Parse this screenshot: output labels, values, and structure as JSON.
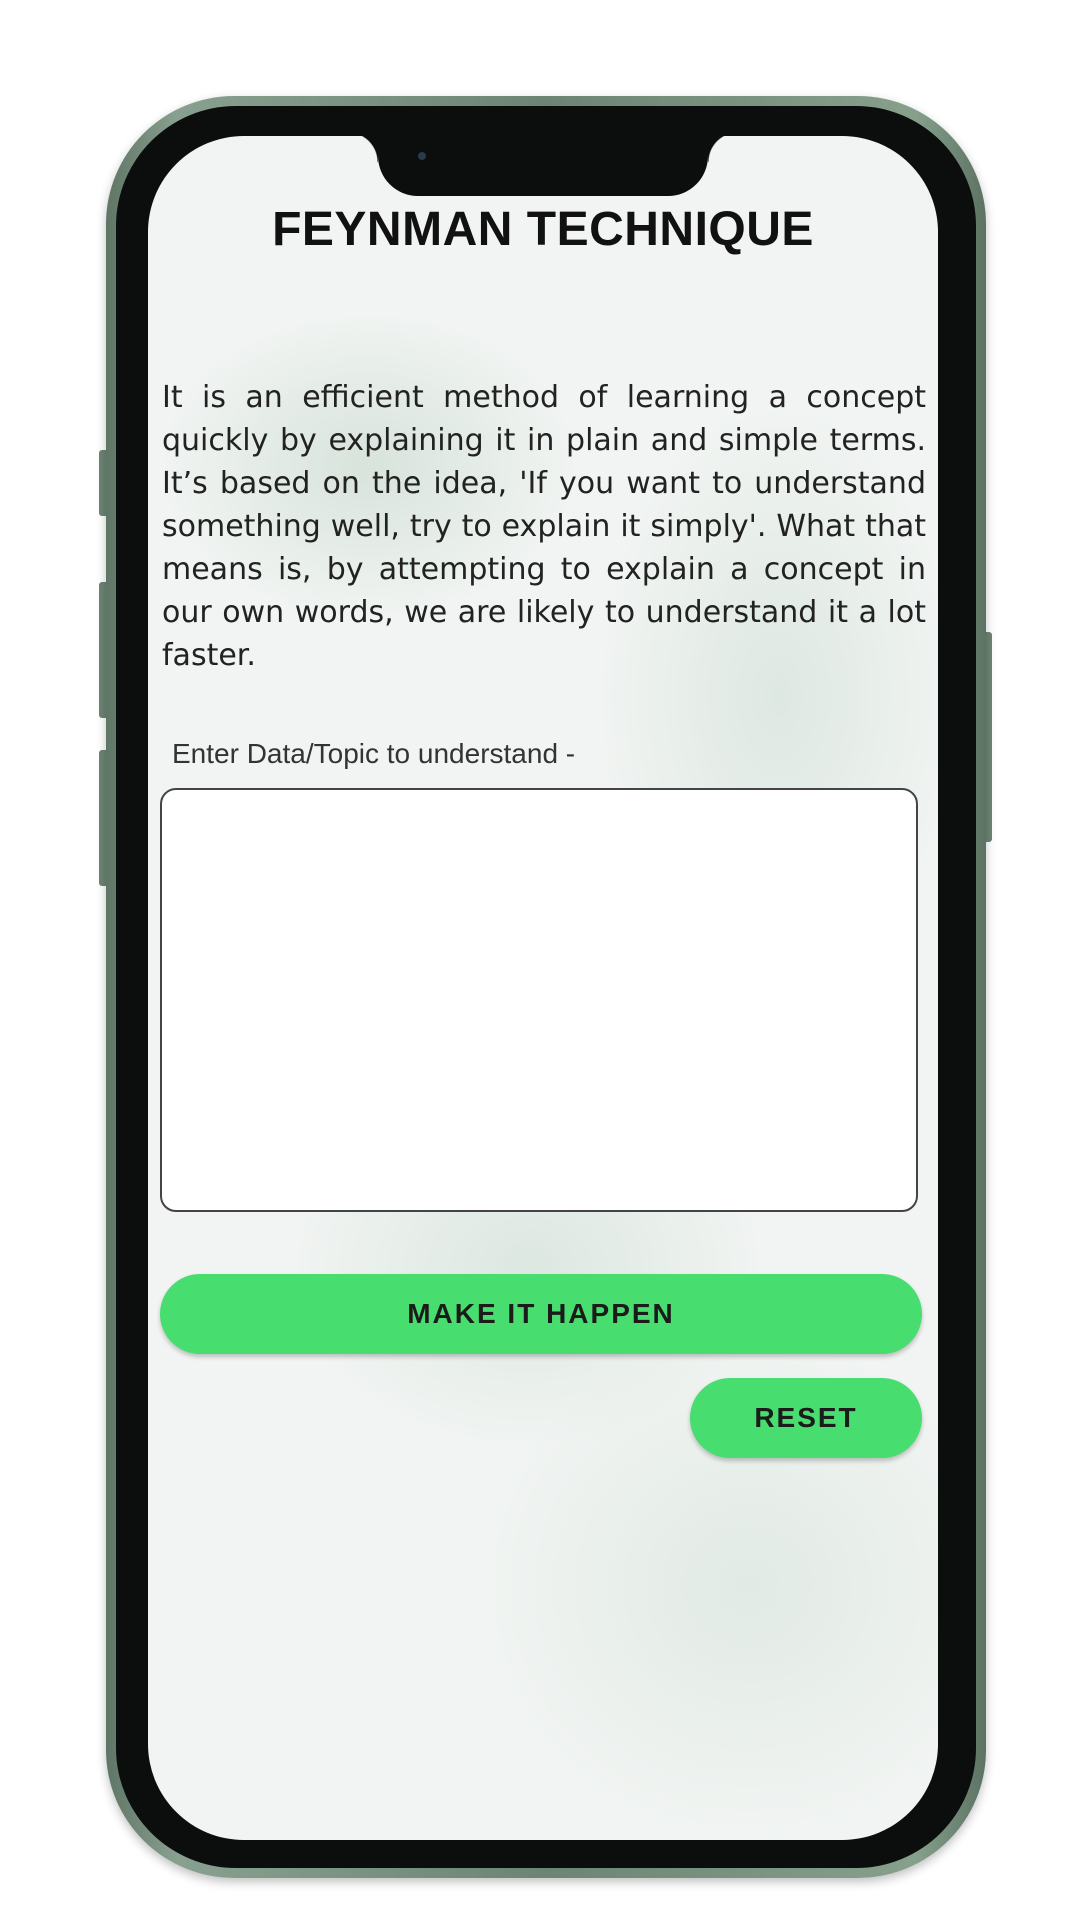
{
  "app": {
    "title": "FEYNMAN TECHNIQUE",
    "description": "It is an efficient method of learning a concept quickly by explaining it in plain and simple terms. It’s based on the idea, 'If you want to understand something well, try to explain it simply'. What that means is, by attempting to explain a concept in our own words, we are likely to understand it a lot faster."
  },
  "input": {
    "label": "Enter Data/Topic to understand -",
    "value": "",
    "placeholder": ""
  },
  "buttons": {
    "primary_label": "MAKE IT HAPPEN",
    "reset_label": "RESET"
  },
  "colors": {
    "accent": "#47dd6f",
    "phone_frame": "#6c8474",
    "bezel": "#0c0e0d",
    "screen_background": "#f1f4f2"
  },
  "icons": {
    "camera": "front-camera-icon"
  }
}
